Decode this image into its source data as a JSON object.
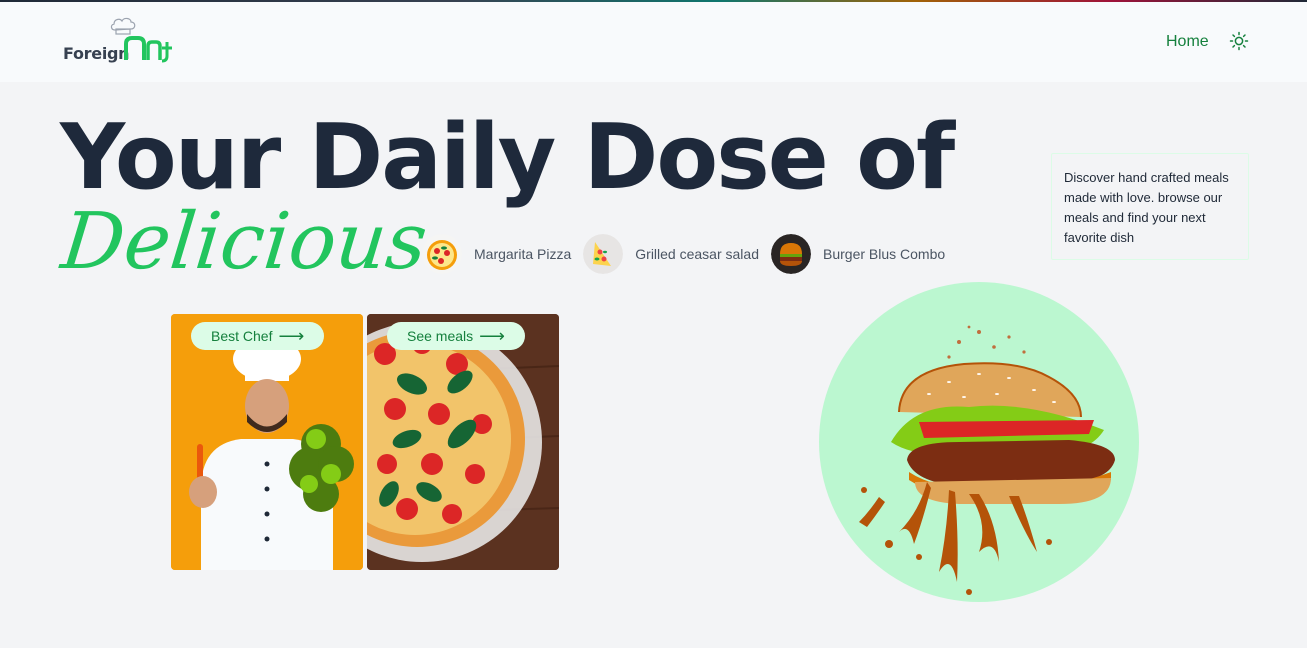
{
  "brand": {
    "name": "Foreign",
    "mark_icon": "ethiopic-script-logo-icon",
    "hat_icon": "chef-hat-icon",
    "color": "#22c55e"
  },
  "nav": {
    "home_label": "Home",
    "theme_toggle_icon": "sun-icon"
  },
  "hero": {
    "headline": "Your Daily Dose of",
    "headline_accent": "Delicious",
    "description": "Discover hand crafted meals made with love. browse our meals and find your next favorite dish"
  },
  "featured_meals": [
    {
      "label": "Margarita Pizza",
      "icon": "pizza-thumbnail"
    },
    {
      "label": "Grilled ceasar salad",
      "icon": "salad-thumbnail"
    },
    {
      "label": "Burger Blus Combo",
      "icon": "burger-thumbnail"
    }
  ],
  "cards": {
    "chef_label": "Best Chef",
    "meals_label": "See meals",
    "arrow": "⟶"
  },
  "colors": {
    "accent": "#22c55e",
    "accent_dark": "#15803d",
    "pill_bg": "#dcfce7",
    "circle_bg": "#bbf7d0",
    "heading": "#1e293b"
  }
}
